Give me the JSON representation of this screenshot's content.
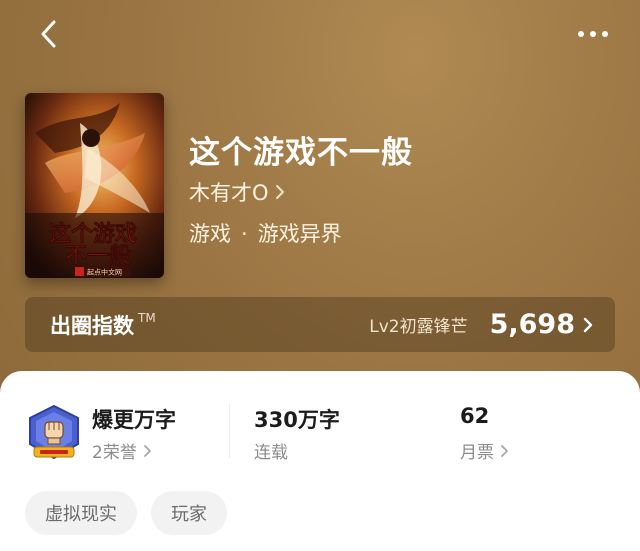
{
  "book": {
    "title": "这个游戏不一般",
    "author": "木有才O",
    "genre": "游戏",
    "subgenre": "游戏异界",
    "genre_separator": "·",
    "cover_title": "这个游戏不一般",
    "cover_publisher": "起点中文网"
  },
  "index": {
    "label": "出圈指数",
    "tm": "TM",
    "level": "Lv2初露锋芒",
    "value": "5,698"
  },
  "stats": {
    "honor_title": "爆更万字",
    "honor_sub": "2荣誉",
    "words_title": "330万字",
    "words_sub": "连载",
    "tickets_title": "62",
    "tickets_sub": "月票"
  },
  "tags": [
    "虚拟现实",
    "玩家"
  ],
  "icons": {
    "back": "back-icon",
    "more": "more-icon",
    "badge": "shield-fist-badge-icon"
  },
  "colors": {
    "header_bg": "#9b7543",
    "card_bg": "#ffffff",
    "tag_bg": "#f2f2f2"
  }
}
